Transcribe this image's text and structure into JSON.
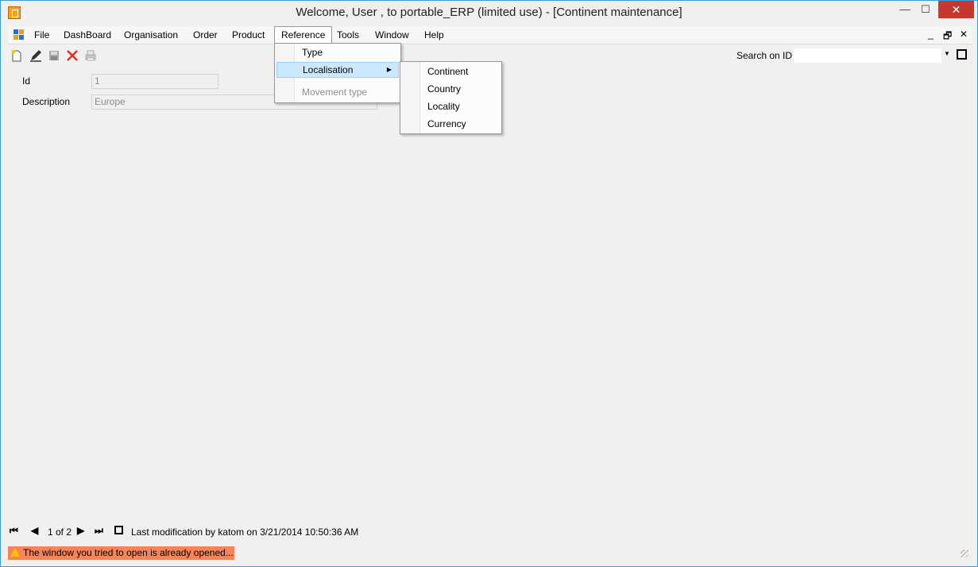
{
  "window": {
    "title": "Welcome, User , to portable_ERP (limited use) - [Continent maintenance]"
  },
  "window_controls": {
    "minimize": "—",
    "maximize": "☐",
    "close": "✕"
  },
  "menubar": {
    "items": [
      "File",
      "DashBoard",
      "Organisation",
      "Order",
      "Product",
      "Reference",
      "Tools",
      "Window",
      "Help"
    ],
    "active": "Reference",
    "mdi_controls": {
      "minimize": "_",
      "restore": "🗗",
      "close": "✕"
    }
  },
  "toolbar": {
    "icons": [
      "new-document-icon",
      "edit-pencil-icon",
      "save-disk-icon",
      "delete-x-icon",
      "print-icon"
    ],
    "search_label": "Search on ID",
    "search_value": ""
  },
  "form": {
    "id_label": "Id",
    "id_value": "1",
    "description_label": "Description",
    "description_value": "Europe"
  },
  "reference_menu": {
    "items": [
      {
        "label": "Type",
        "state": "normal"
      },
      {
        "label": "Localisation",
        "state": "highlighted",
        "submenu": true
      },
      {
        "label": "Movement type",
        "state": "disabled"
      }
    ]
  },
  "localisation_submenu": {
    "items": [
      "Continent",
      "Country",
      "Locality",
      "Currency"
    ]
  },
  "navigator": {
    "first": "⏮",
    "prev": "◀",
    "position": "1 of 2",
    "next": "▶",
    "last": "⏭",
    "modification": "Last modification by katom on 3/21/2014 10:50:36 AM"
  },
  "status": {
    "message": "The window you tried to open is already opened...",
    "warning_color": "#f5845a"
  }
}
